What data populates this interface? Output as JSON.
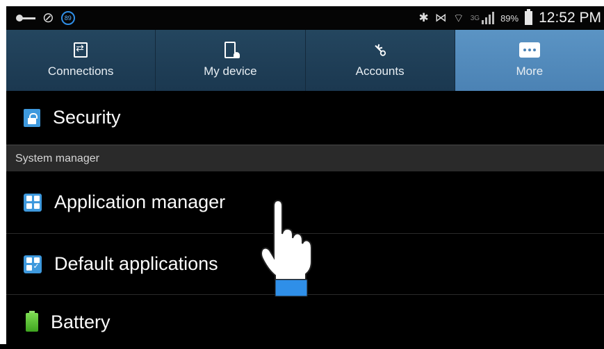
{
  "status_bar": {
    "notification_badge": "89",
    "network_type": "3G",
    "battery_percent": "89%",
    "time": "12:52 PM"
  },
  "tabs": [
    {
      "label": "Connections",
      "icon": "connections-icon",
      "active": false
    },
    {
      "label": "My device",
      "icon": "my-device-icon",
      "active": false
    },
    {
      "label": "Accounts",
      "icon": "key-icon",
      "active": false
    },
    {
      "label": "More",
      "icon": "more-icon",
      "active": true
    }
  ],
  "list": {
    "security_label": "Security",
    "section_header": "System manager",
    "app_manager_label": "Application manager",
    "default_apps_label": "Default applications",
    "battery_label": "Battery"
  },
  "colors": {
    "accent_blue": "#3e99dd",
    "active_tab": "#4b82b4",
    "tab_bg": "#1f3d57"
  }
}
